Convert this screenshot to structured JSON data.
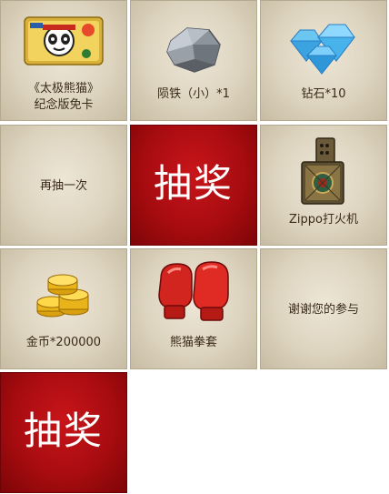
{
  "prizes": {
    "card": {
      "label_line1": "《太极熊猫》",
      "label_line2": "纪念版免卡",
      "icon": "card-icon"
    },
    "meteorite": {
      "label": "陨铁（小）*1",
      "icon": "rock-icon"
    },
    "diamond": {
      "label": "钻石*10",
      "icon": "diamond-icon"
    },
    "redraw": {
      "label": "再抽一次"
    },
    "zippo": {
      "label": "Zippo打火机",
      "icon": "lighter-icon"
    },
    "gold": {
      "label": "金币*200000",
      "icon": "coins-icon"
    },
    "gloves": {
      "label": "熊猫拳套",
      "icon": "boxing-gloves-icon"
    },
    "thanks": {
      "label": "谢谢您的参与"
    }
  },
  "draw_center": {
    "label": "抽奖"
  },
  "draw_button": {
    "label": "抽奖"
  },
  "colors": {
    "draw_red": "#a80c10",
    "tile_parchment": "#ddd4bf",
    "text": "#3a2a18"
  }
}
